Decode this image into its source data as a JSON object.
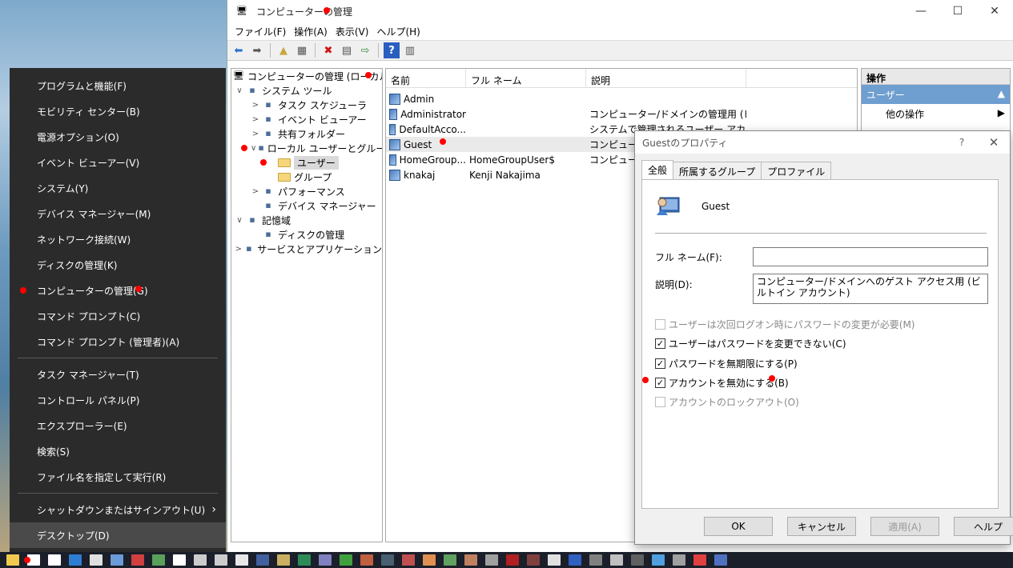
{
  "window": {
    "title": "コンピューターの管理",
    "menu": [
      "ファイル(F)",
      "操作(A)",
      "表示(V)",
      "ヘルプ(H)"
    ]
  },
  "tree": {
    "root": "コンピューターの管理 (ローカル)",
    "items": [
      {
        "label": "システム ツール",
        "level": 1,
        "expander": "∨",
        "icon": "tools-icon"
      },
      {
        "label": "タスク スケジューラ",
        "level": 2,
        "expander": ">",
        "icon": "clock-icon"
      },
      {
        "label": "イベント ビューアー",
        "level": 2,
        "expander": ">",
        "icon": "event-viewer-icon"
      },
      {
        "label": "共有フォルダー",
        "level": 2,
        "expander": ">",
        "icon": "shared-folder-icon"
      },
      {
        "label": "ローカル ユーザーとグループ",
        "level": 2,
        "expander": "∨",
        "icon": "users-groups-icon"
      },
      {
        "label": "ユーザー",
        "level": 3,
        "expander": "",
        "icon": "folder-icon",
        "selected": true
      },
      {
        "label": "グループ",
        "level": 3,
        "expander": "",
        "icon": "folder-icon"
      },
      {
        "label": "パフォーマンス",
        "level": 2,
        "expander": ">",
        "icon": "performance-icon"
      },
      {
        "label": "デバイス マネージャー",
        "level": 2,
        "expander": "",
        "icon": "device-manager-icon"
      },
      {
        "label": "記憶域",
        "level": 1,
        "expander": "∨",
        "icon": "storage-icon"
      },
      {
        "label": "ディスクの管理",
        "level": 2,
        "expander": "",
        "icon": "disk-icon"
      },
      {
        "label": "サービスとアプリケーション",
        "level": 1,
        "expander": ">",
        "icon": "services-icon"
      }
    ]
  },
  "list": {
    "headers": [
      "名前",
      "フル ネーム",
      "説明"
    ],
    "rows": [
      {
        "name": "Admin",
        "full": "",
        "desc": ""
      },
      {
        "name": "Administrator",
        "full": "",
        "desc": "コンピューター/ドメインの管理用 (ビルト..."
      },
      {
        "name": "DefaultAcco...",
        "full": "",
        "desc": "システムで管理されるユーザー アカウン..."
      },
      {
        "name": "Guest",
        "full": "",
        "desc": "コンピューター",
        "hl": true
      },
      {
        "name": "HomeGroup...",
        "full": "HomeGroupUser$",
        "desc": "コンピューター"
      },
      {
        "name": "knakaj",
        "full": "Kenji Nakajima",
        "desc": ""
      }
    ]
  },
  "actions": {
    "header": "操作",
    "sub": "ユーザー",
    "more": "他の操作"
  },
  "context_menu": {
    "group1": [
      "プログラムと機能(F)",
      "モビリティ センター(B)",
      "電源オプション(O)",
      "イベント ビューアー(V)",
      "システム(Y)",
      "デバイス マネージャー(M)",
      "ネットワーク接続(W)",
      "ディスクの管理(K)",
      "コンピューターの管理(G)",
      "コマンド プロンプト(C)",
      "コマンド プロンプト (管理者)(A)"
    ],
    "group2": [
      "タスク マネージャー(T)",
      "コントロール パネル(P)",
      "エクスプローラー(E)",
      "検索(S)",
      "ファイル名を指定して実行(R)"
    ],
    "group3": [
      "シャットダウンまたはサインアウト(U)",
      "デスクトップ(D)"
    ]
  },
  "dialog": {
    "title": "Guestのプロパティ",
    "help": "?",
    "tabs": [
      "全般",
      "所属するグループ",
      "プロファイル"
    ],
    "username": "Guest",
    "fullname_label": "フル ネーム(F):",
    "fullname_value": "",
    "desc_label": "説明(D):",
    "desc_value": "コンピューター/ドメインへのゲスト アクセス用 (ビルトイン アカウント)",
    "checks": [
      {
        "label": "ユーザーは次回ログオン時にパスワードの変更が必要(M)",
        "checked": false,
        "disabled": true
      },
      {
        "label": "ユーザーはパスワードを変更できない(C)",
        "checked": true,
        "disabled": false
      },
      {
        "label": "パスワードを無期限にする(P)",
        "checked": true,
        "disabled": false
      },
      {
        "label": "アカウントを無効にする(B)",
        "checked": true,
        "disabled": false
      },
      {
        "label": "アカウントのロックアウト(O)",
        "checked": false,
        "disabled": true
      }
    ],
    "buttons": {
      "ok": "OK",
      "cancel": "キャンセル",
      "apply": "適用(A)",
      "help": "ヘルプ"
    }
  }
}
